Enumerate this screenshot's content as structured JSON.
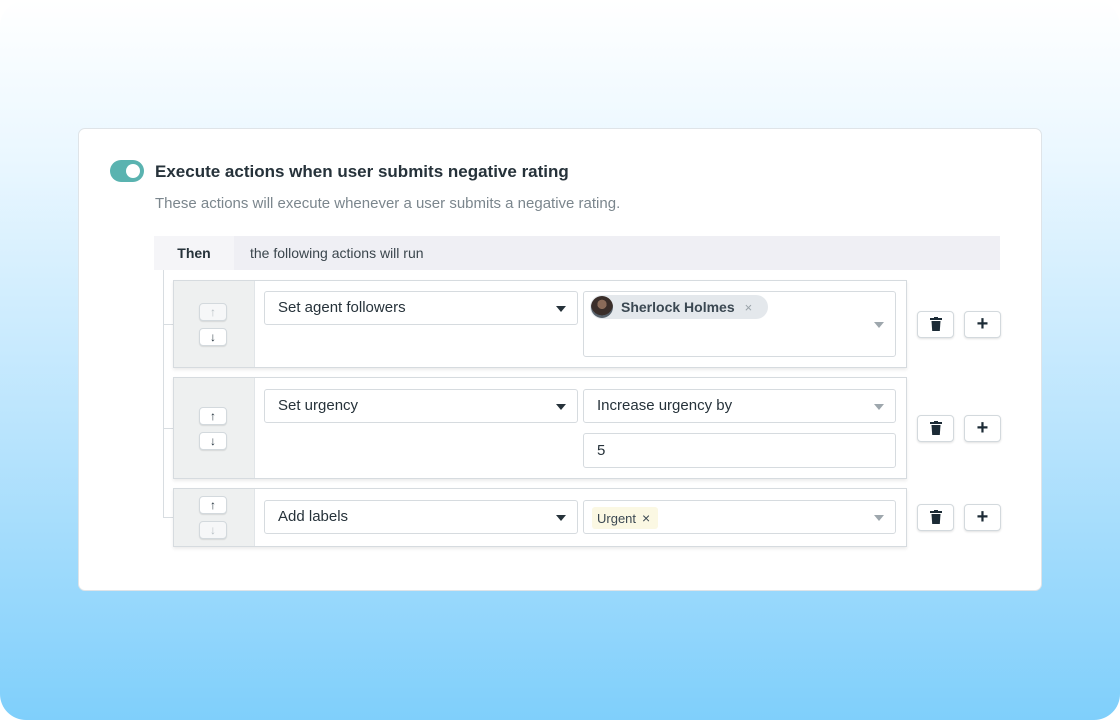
{
  "rule": {
    "enabled": true,
    "title": "Execute actions when user submits negative rating",
    "subtitle": "These actions will execute whenever a user submits a negative rating."
  },
  "then_bar": {
    "label": "Then",
    "text": "the following actions will run"
  },
  "actions": [
    {
      "action": "Set agent followers",
      "chip": {
        "label": "Sherlock Holmes",
        "remove": "×"
      },
      "move_up_enabled": false,
      "move_down_enabled": true
    },
    {
      "action": "Set urgency",
      "mode": "Increase urgency by",
      "value": "5",
      "move_up_enabled": true,
      "move_down_enabled": true
    },
    {
      "action": "Add labels",
      "tag": {
        "label": "Urgent",
        "remove": "×"
      },
      "move_up_enabled": true,
      "move_down_enabled": false
    }
  ],
  "icons": {
    "move_up": "↑",
    "move_down": "↓",
    "add": "+",
    "delete": "trash-icon"
  },
  "colors": {
    "toggle_on": "#5ab3b0",
    "chip_bg": "#e4e8ec",
    "tag_bg": "#fbf8e3"
  }
}
